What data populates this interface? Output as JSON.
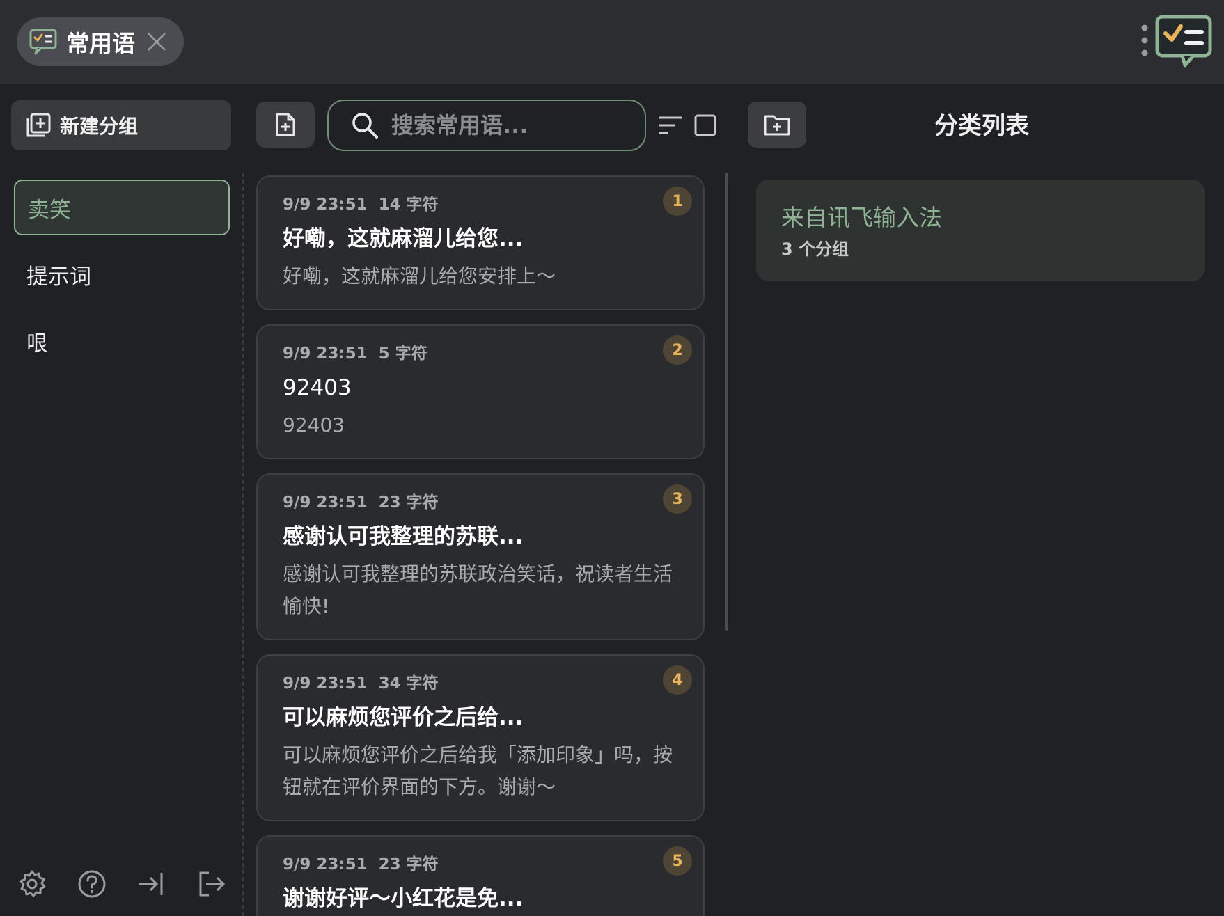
{
  "tab": {
    "label": "常用语",
    "icon": "chat-checklist-icon",
    "close_icon": "close-icon"
  },
  "header": {
    "menu_icon": "kebab-menu-icon",
    "logo_icon": "app-logo-icon"
  },
  "sidebar": {
    "new_group_label": "新建分组",
    "groups": [
      {
        "label": "卖笑",
        "active": true
      },
      {
        "label": "提示词",
        "active": false
      },
      {
        "label": "哏",
        "active": false
      }
    ],
    "footer_icons": [
      "gear-icon",
      "help-icon",
      "login-icon",
      "logout-icon"
    ]
  },
  "search": {
    "placeholder": "搜索常用语..."
  },
  "phrases": [
    {
      "time": "9/9 23:51",
      "chars": "14 字符",
      "title": "好嘞，这就麻溜儿给您...",
      "body": "好嘞，这就麻溜儿给您安排上～",
      "index": "1"
    },
    {
      "time": "9/9 23:51",
      "chars": "5 字符",
      "title": "92403",
      "body": "92403",
      "index": "2"
    },
    {
      "time": "9/9 23:51",
      "chars": "23 字符",
      "title": "感谢认可我整理的苏联...",
      "body": "感谢认可我整理的苏联政治笑话，祝读者生活愉快!",
      "index": "3"
    },
    {
      "time": "9/9 23:51",
      "chars": "34 字符",
      "title": "可以麻烦您评价之后给...",
      "body": "可以麻烦您评价之后给我「添加印象」吗，按钮就在评价界面的下方。谢谢～",
      "index": "4"
    },
    {
      "time": "9/9 23:51",
      "chars": "23 字符",
      "title": "谢谢好评～小红花是免...",
      "body": "",
      "index": "5"
    }
  ],
  "categories": {
    "title": "分类列表",
    "items": [
      {
        "name": "来自讯飞输入法",
        "count": "3 个分组"
      }
    ]
  },
  "colors": {
    "accent_green": "#8fb394",
    "badge_text": "#e8b35a",
    "background": "#1f2124",
    "card": "#2a2b2f"
  }
}
